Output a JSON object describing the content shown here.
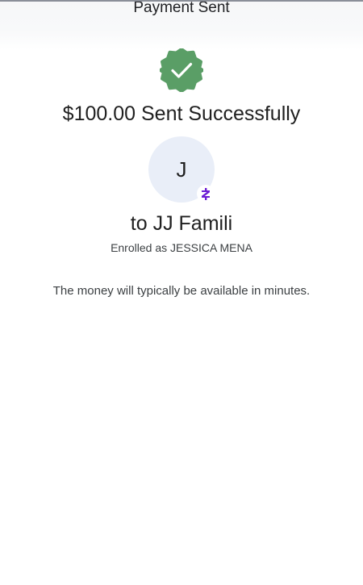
{
  "header": {
    "title": "Payment Sent"
  },
  "status": {
    "icon": "check-circle-icon",
    "icon_color": "#5a9e66",
    "headline": "$100.00 Sent Successfully"
  },
  "recipient": {
    "avatar_initial": "J",
    "avatar_bg": "#e9eef8",
    "badge_icon": "zelle-logo-icon",
    "badge_color": "#6d1ed4",
    "name_line": "to JJ Famili",
    "enrolled_line": "Enrolled as JESSICA MENA"
  },
  "info": {
    "availability_text": "The money will typically be available in minutes."
  }
}
